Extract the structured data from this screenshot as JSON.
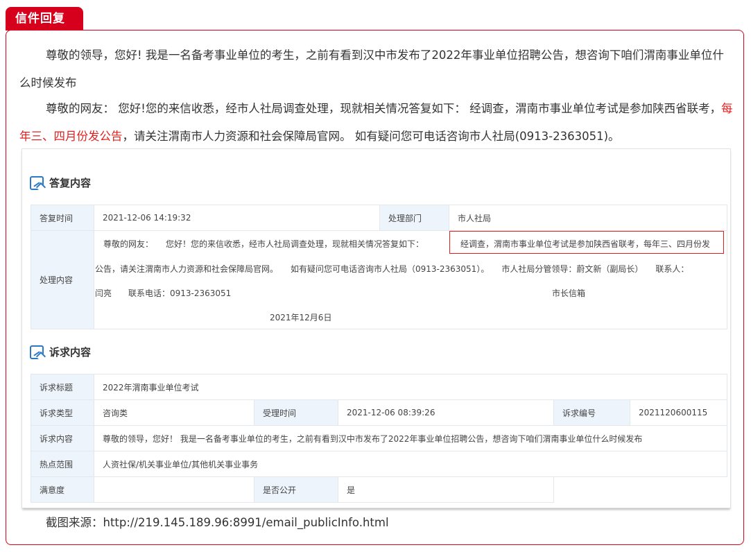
{
  "tab_label": "信件回复",
  "article": {
    "p1": "尊敬的领导，您好! 我是一名备考事业单位的考生，之前有看到汉中市发布了2022年事业单位招聘公告，想咨询下咱们渭南事业单位什么时候发布",
    "p2_a": "尊敬的网友： 您好!您的来信收悉，经市人社局调查处理，现就相关情况答复如下： 经调查，渭南市事业单位考试是参加陕西省联考，",
    "p2_red": "每年三、四月份发公告",
    "p2_b": "，请关注渭南市人力资源和社会保障局官网。 如有疑问您可电话咨询市人社局(0913-2363051)。"
  },
  "reply": {
    "title": "答复内容",
    "time_label": "答复时间",
    "time_value": "2021-12-06 14:19:32",
    "dept_label": "处理部门",
    "dept_value": "市人社局",
    "content_label": "处理内容",
    "line1": "尊敬的网友：　　您好！您的来信收悉，经市人社局调查处理，现就相关情况答复如下：",
    "line1_box": "经调查，渭南市事业单位考试是参加陕西省联考，每年三、四月份发",
    "line2": "公告，请关注渭南市人力资源和社会保障局官网。　　如有疑问您可电话咨询市人社局（0913-2363051）。　　市人社局分管领导：蔚文新（副局长）　　联系人：",
    "line3a": "闫亮　　联系电话：0913-2363051",
    "line3b": "市长信箱",
    "line4": "2021年12月6日"
  },
  "request": {
    "title": "诉求内容",
    "title_label": "诉求标题",
    "title_value": "2022年渭南事业单位考试",
    "type_label": "诉求类型",
    "type_value": "咨询类",
    "accept_label": "受理时间",
    "accept_value": "2021-12-06 08:39:26",
    "no_label": "诉求编号",
    "no_value": "2021120600115",
    "content_label": "诉求内容",
    "content_value": "尊敬的领导，您好！ 我是一名备考事业单位的考生，之前有看到汉中市发布了2022年事业单位招聘公告，想咨询下咱们渭南事业单位什么时候发布",
    "hot_label": "热点范围",
    "hot_value": "人资社保/机关事业单位/其他机关事业事务",
    "satis_label": "满意度",
    "satis_value": "",
    "public_label": "是否公开",
    "public_value": "是"
  },
  "caption": "截图来源：http://219.145.189.96:8991/email_publicInfo.html",
  "colors": {
    "accent_red": "#d6001c",
    "label_bg": "#eef4fb",
    "icon_blue": "#2a79c6"
  }
}
